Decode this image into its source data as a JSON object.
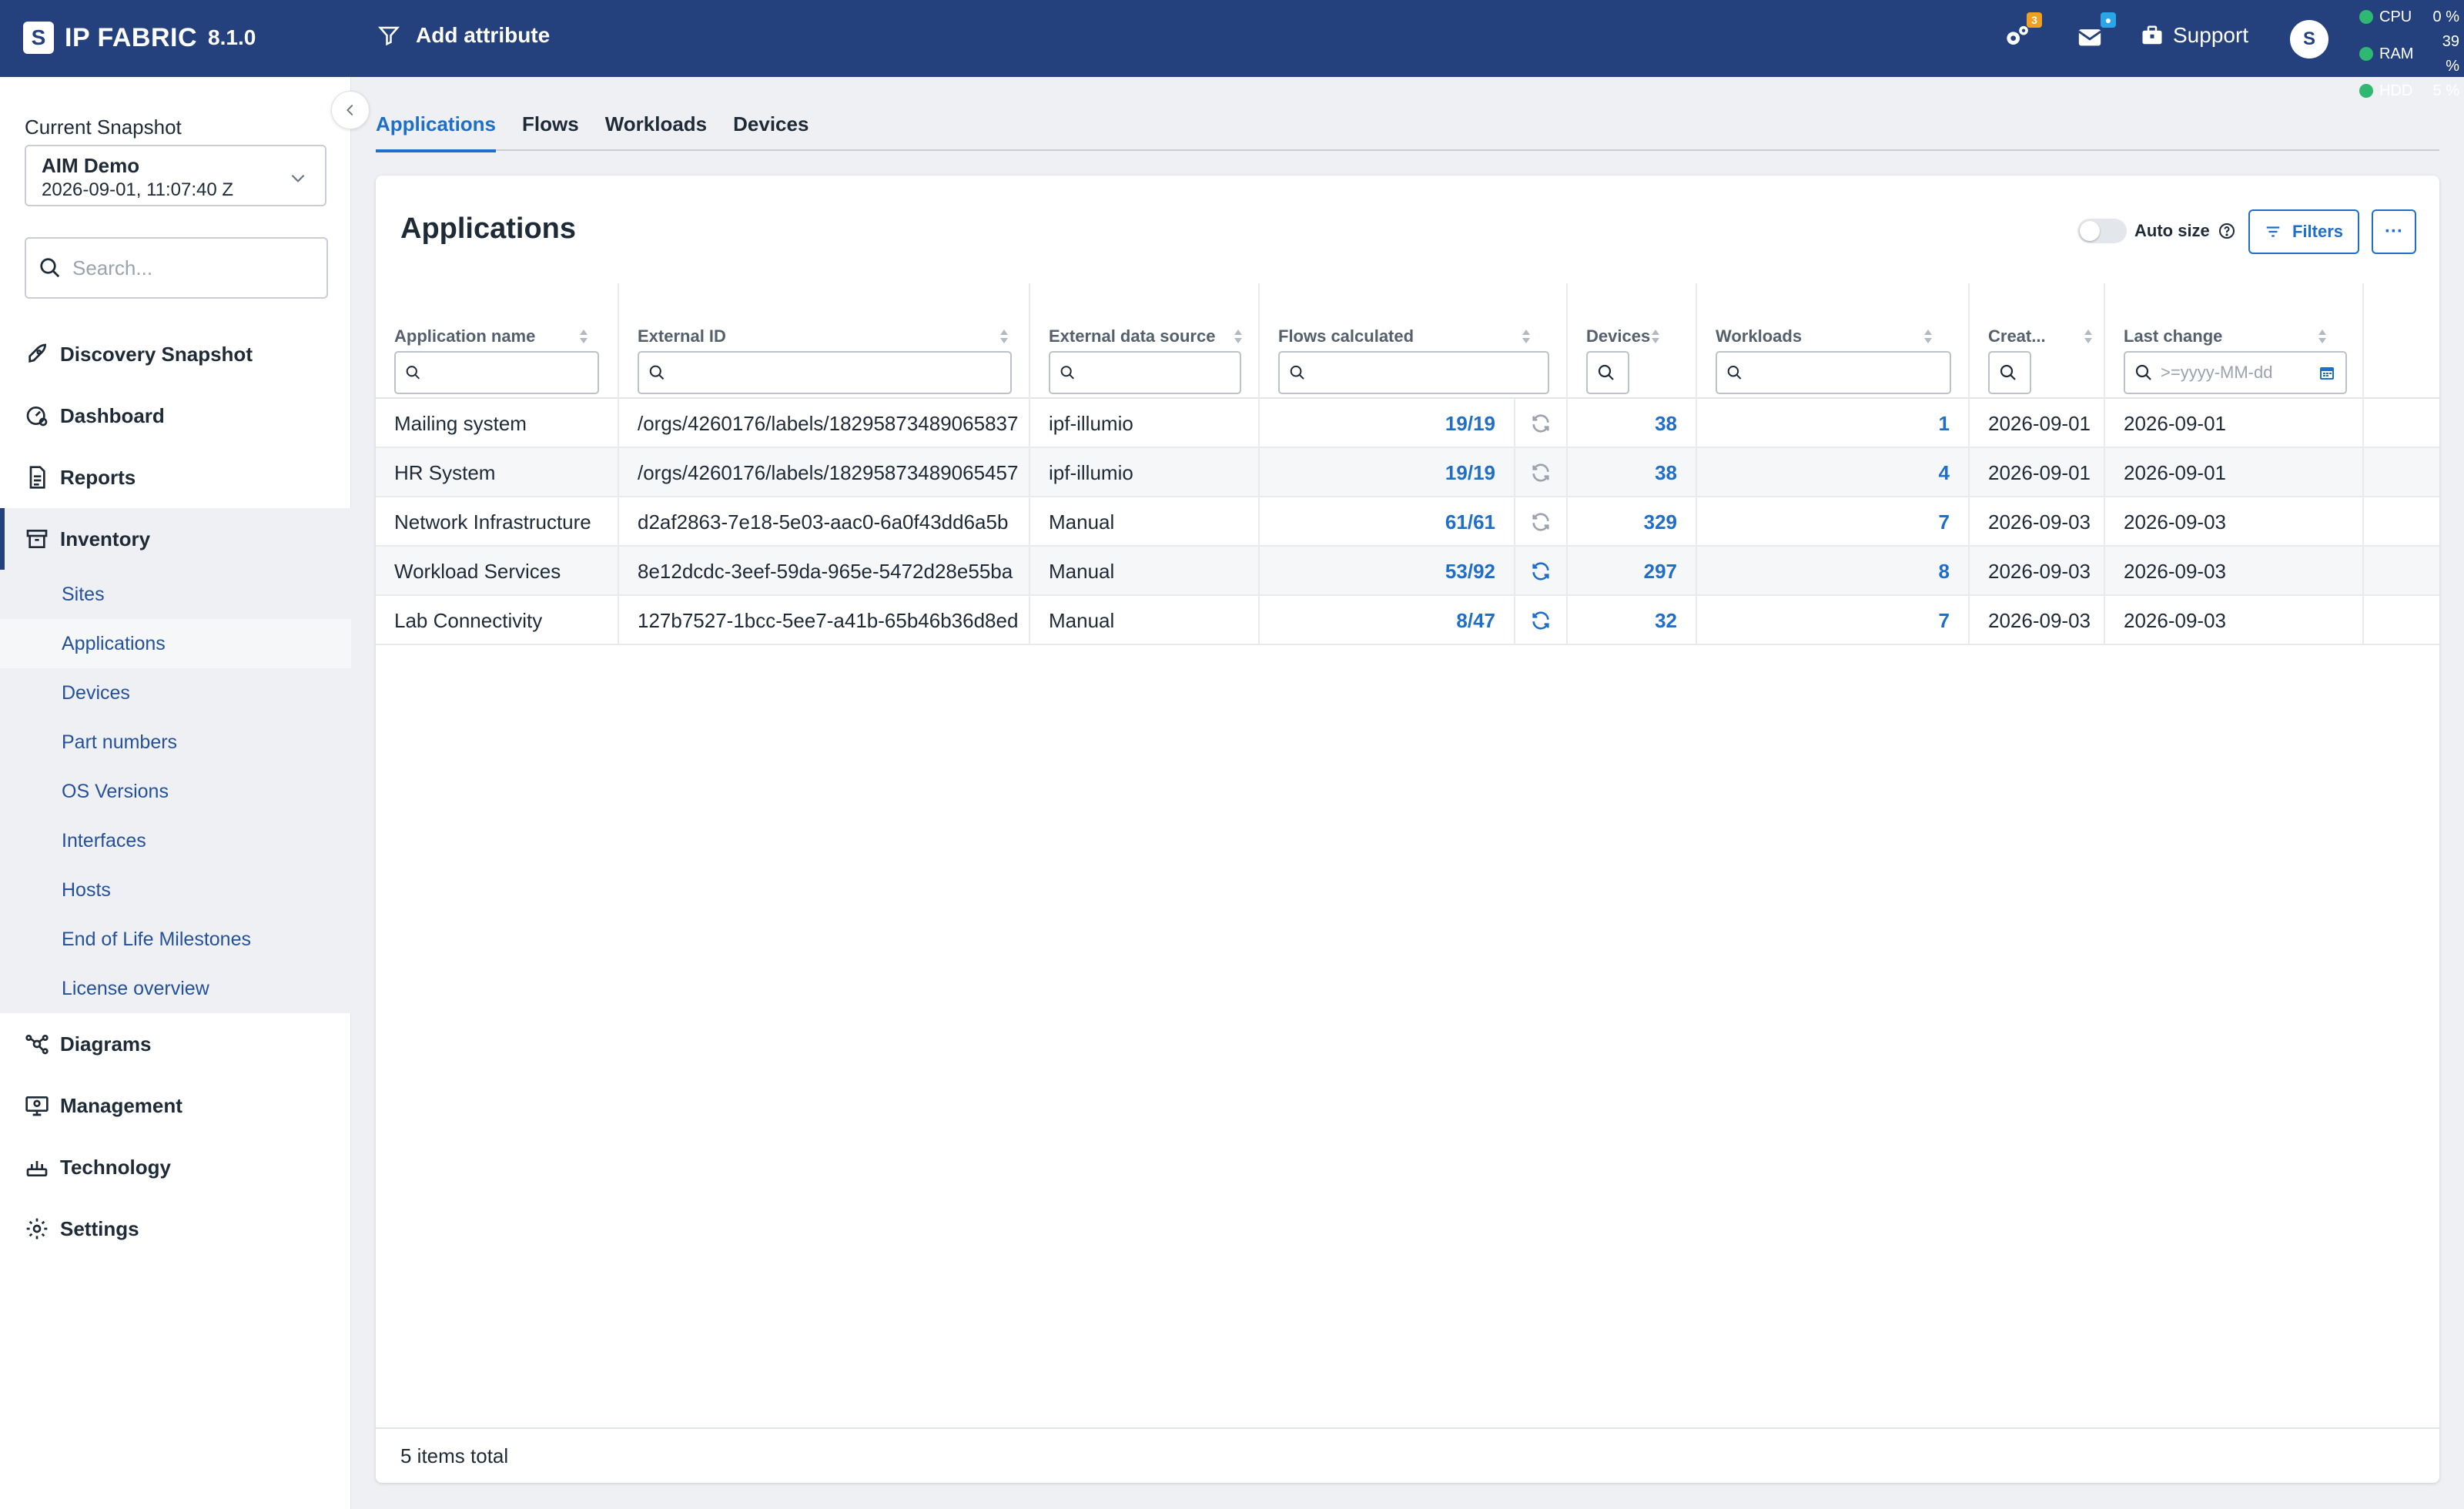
{
  "topbar": {
    "logo_text": "IP FABRIC",
    "version": "8.1.0",
    "add_attribute": "Add attribute",
    "settings_badge": "3",
    "messages_badge": "",
    "support": "Support",
    "stats": [
      {
        "label": "CPU",
        "value": "0 %"
      },
      {
        "label": "RAM",
        "value": "39 %"
      },
      {
        "label": "HDD",
        "value": "5 %"
      }
    ]
  },
  "sidebar": {
    "snapshot_label": "Current Snapshot",
    "snapshot_name": "AIM Demo",
    "snapshot_date": "2026-09-01, 11:07:40 Z",
    "search_placeholder": "Search...",
    "nav": [
      {
        "label": "Discovery Snapshot",
        "icon": "rocket-icon"
      },
      {
        "label": "Dashboard",
        "icon": "dashboard-icon"
      },
      {
        "label": "Reports",
        "icon": "report-icon"
      },
      {
        "label": "Inventory",
        "icon": "inventory-icon"
      }
    ],
    "inventory_items": [
      "Sites",
      "Applications",
      "Devices",
      "Part numbers",
      "OS Versions",
      "Interfaces",
      "Hosts",
      "End of Life Milestones",
      "License overview"
    ],
    "nav_bottom": [
      {
        "label": "Diagrams",
        "icon": "diagram-icon"
      },
      {
        "label": "Management",
        "icon": "management-icon"
      },
      {
        "label": "Technology",
        "icon": "technology-icon"
      },
      {
        "label": "Settings",
        "icon": "gear-icon"
      }
    ]
  },
  "tabs": [
    "Applications",
    "Flows",
    "Workloads",
    "Devices"
  ],
  "card": {
    "title": "Applications",
    "autosize_label": "Auto size",
    "filters_label": "Filters",
    "more_label": "···",
    "total": "5 items total"
  },
  "table": {
    "columns": [
      "Application name",
      "External ID",
      "External data source",
      "Flows calculated",
      "Devices",
      "Workloads",
      "Creat...",
      "Last change"
    ],
    "date_placeholder": ">=yyyy-MM-dd",
    "rows": [
      {
        "name": "Mailing system",
        "external_id": "/orgs/4260176/labels/18295873489065837",
        "source": "ipf-illumio",
        "flows": "19/19",
        "sync_active": false,
        "devices": "38",
        "workloads": "1",
        "created": "2026-09-01",
        "last_change": "2026-09-01"
      },
      {
        "name": "HR System",
        "external_id": "/orgs/4260176/labels/18295873489065457",
        "source": "ipf-illumio",
        "flows": "19/19",
        "sync_active": false,
        "devices": "38",
        "workloads": "4",
        "created": "2026-09-01",
        "last_change": "2026-09-01"
      },
      {
        "name": "Network Infrastructure",
        "external_id": "d2af2863-7e18-5e03-aac0-6a0f43dd6a5b",
        "source": "Manual",
        "flows": "61/61",
        "sync_active": false,
        "devices": "329",
        "workloads": "7",
        "created": "2026-09-03",
        "last_change": "2026-09-03"
      },
      {
        "name": "Workload Services",
        "external_id": "8e12dcdc-3eef-59da-965e-5472d28e55ba",
        "source": "Manual",
        "flows": "53/92",
        "sync_active": true,
        "devices": "297",
        "workloads": "8",
        "created": "2026-09-03",
        "last_change": "2026-09-03"
      },
      {
        "name": "Lab Connectivity",
        "external_id": "127b7527-1bcc-5ee7-a41b-65b46b36d8ed",
        "source": "Manual",
        "flows": "8/47",
        "sync_active": true,
        "devices": "32",
        "workloads": "7",
        "created": "2026-09-03",
        "last_change": "2026-09-03"
      }
    ]
  },
  "colors": {
    "topbar": "#24417d",
    "accent": "#1f6fc9",
    "badge_orange": "#f0a020",
    "badge_blue": "#2aa5e8",
    "status_green": "#2eb872"
  }
}
